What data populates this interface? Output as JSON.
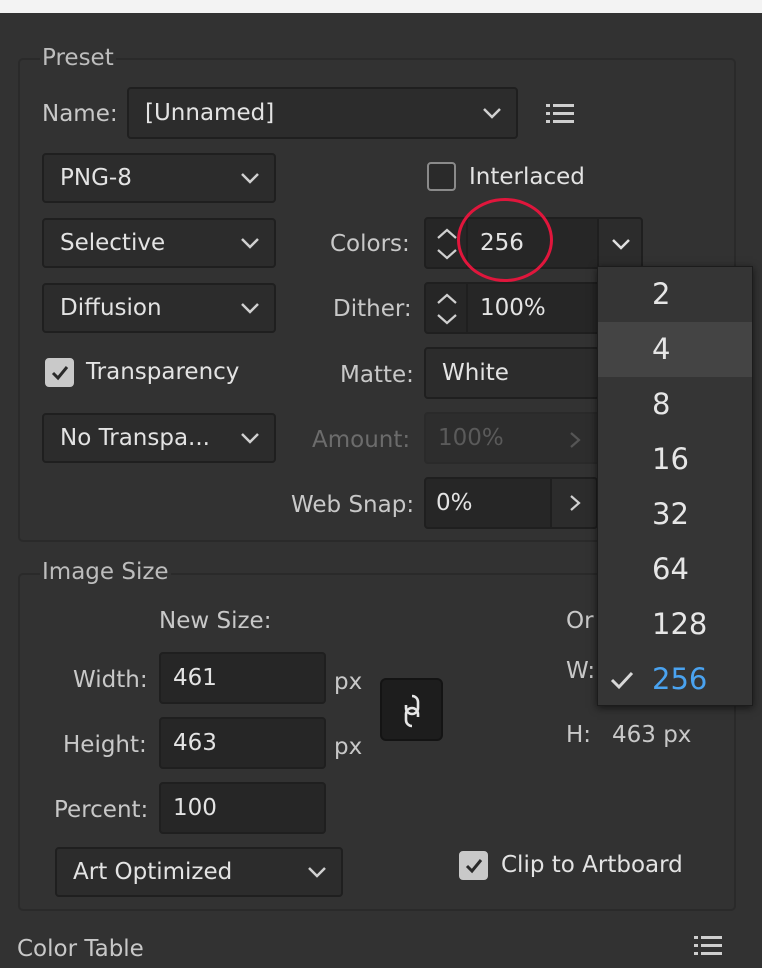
{
  "preset": {
    "legend": "Preset",
    "name_label": "Name:",
    "name_value": "[Unnamed]",
    "format": "PNG-8",
    "interlaced_label": "Interlaced",
    "interlaced_checked": false,
    "reduction": "Selective",
    "dither_algo": "Diffusion",
    "transparency_label": "Transparency",
    "transparency_checked": true,
    "transparency_dither": "No Transpa...",
    "colors_label": "Colors:",
    "colors_value": "256",
    "dither_label": "Dither:",
    "dither_value": "100%",
    "matte_label": "Matte:",
    "matte_value": "White",
    "amount_label": "Amount:",
    "amount_value": "100%",
    "websnap_label": "Web Snap:",
    "websnap_value": "0%"
  },
  "colors_menu": {
    "items": [
      "2",
      "4",
      "8",
      "16",
      "32",
      "64",
      "128",
      "256"
    ],
    "hovered": "4",
    "selected": "256"
  },
  "image_size": {
    "legend": "Image Size",
    "new_size_label": "New Size:",
    "width_label": "Width:",
    "width_value": "461",
    "height_label": "Height:",
    "height_value": "463",
    "percent_label": "Percent:",
    "percent_value": "100",
    "unit": "px",
    "unit2": "px",
    "quality": "Art Optimized",
    "original_label_partial": "Or",
    "w_label_partial": "W:",
    "h_label": "H:",
    "h_value": "463 px",
    "clip_label": "Clip to Artboard",
    "clip_checked": true
  },
  "color_table": {
    "title": "Color Table"
  },
  "colors": {
    "accent_selected": "#4aa3f0",
    "highlight_circle": "#e0163c"
  }
}
